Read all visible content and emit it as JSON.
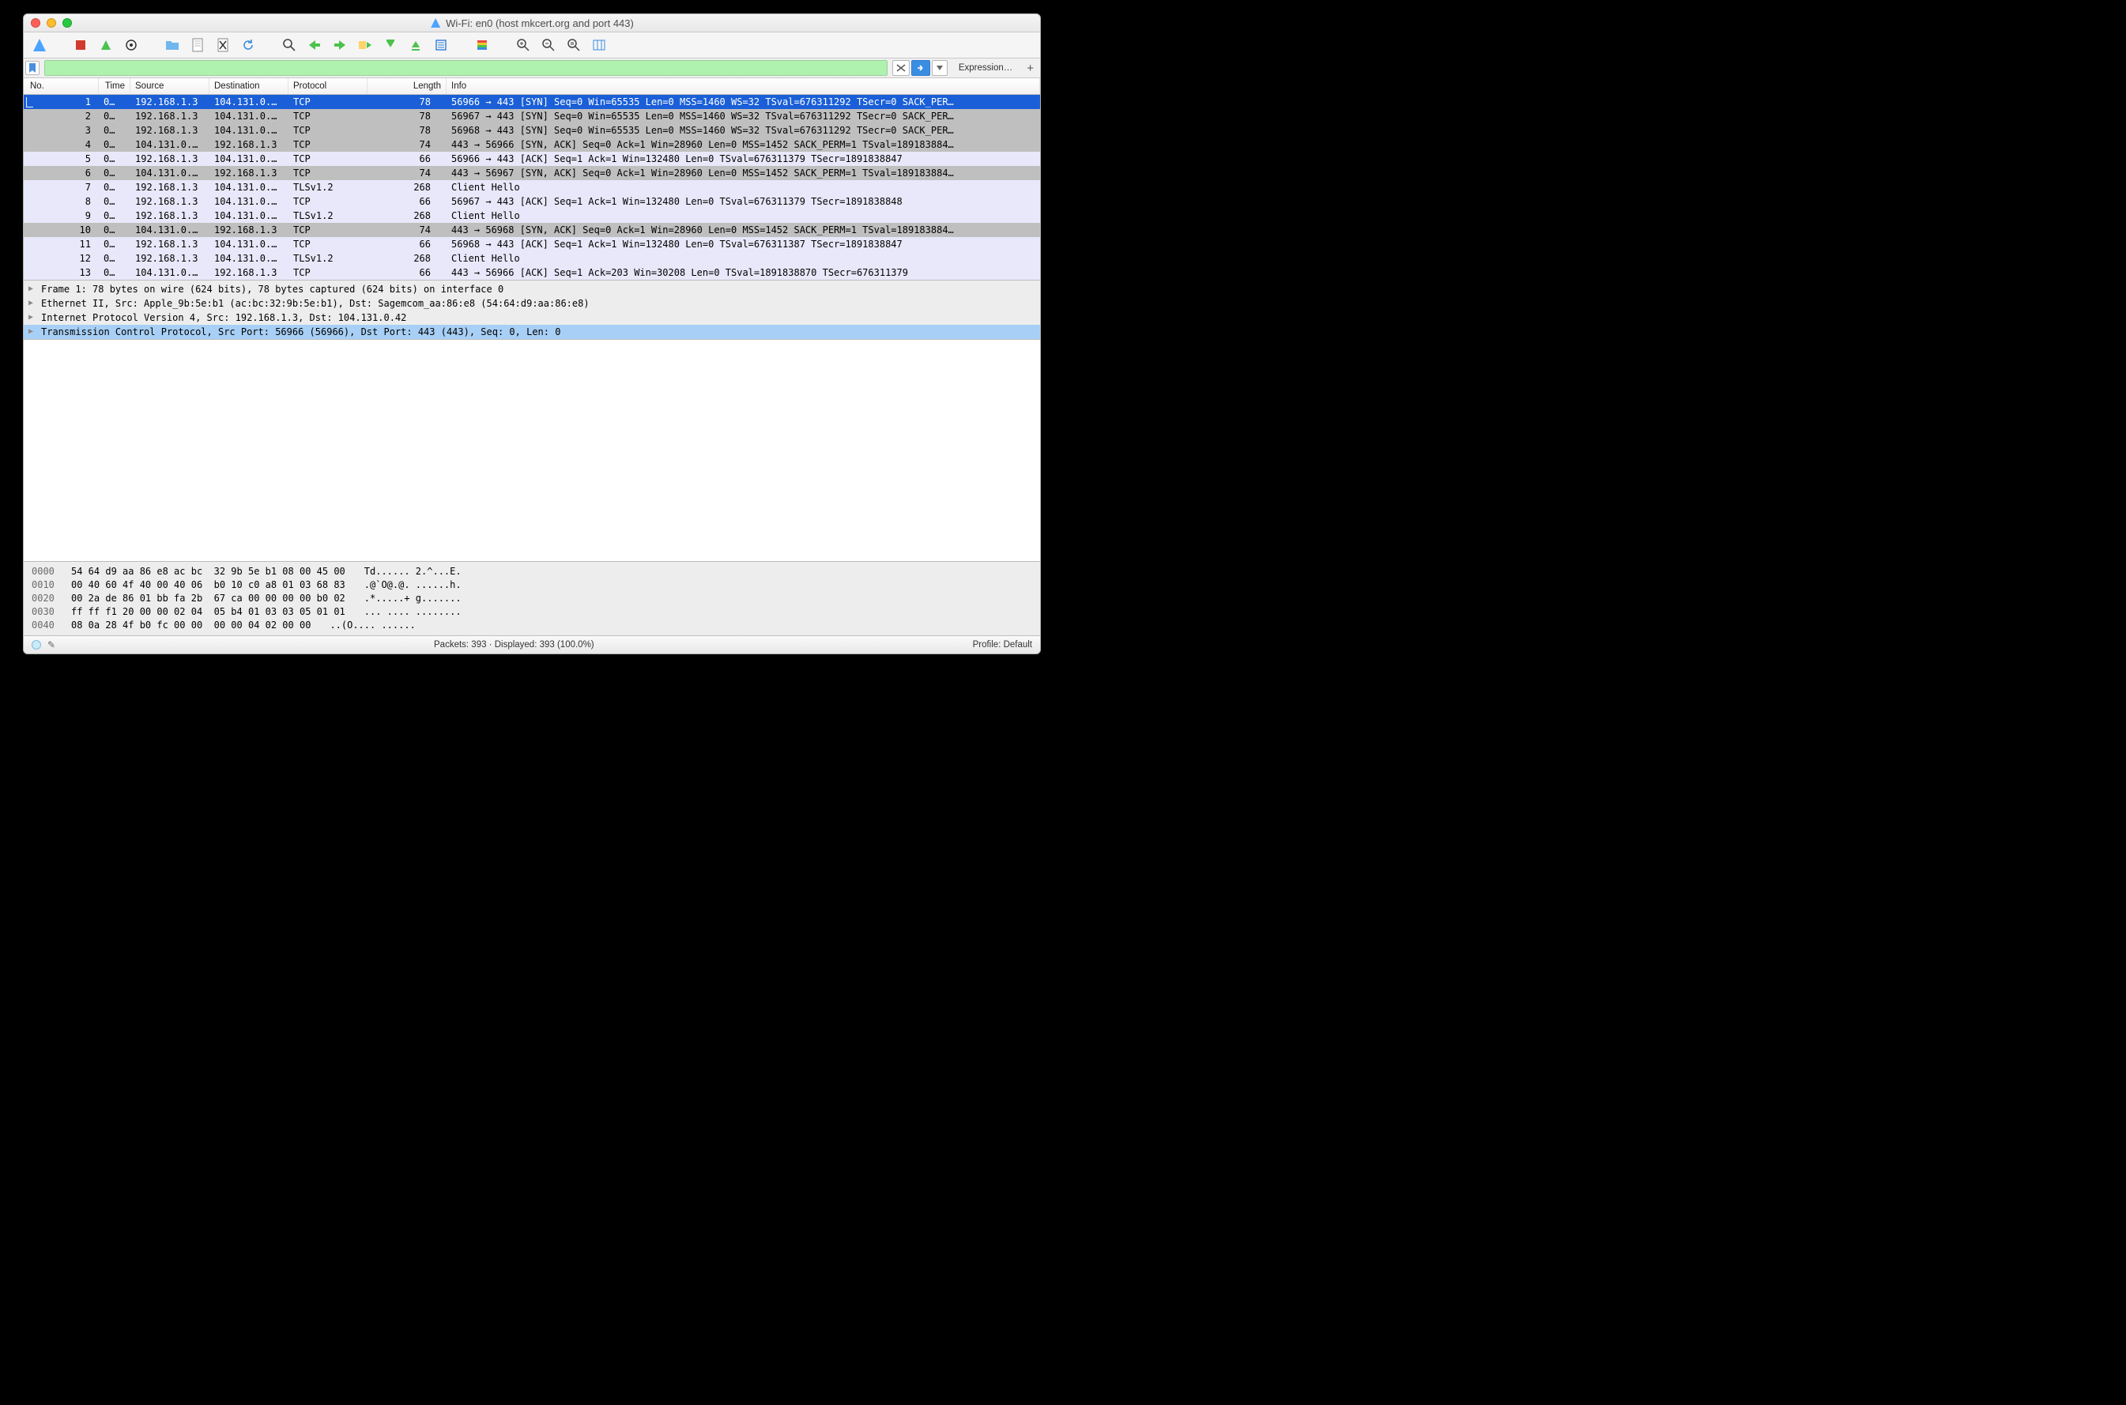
{
  "window": {
    "title": "Wi-Fi: en0 (host mkcert.org and port 443)"
  },
  "filter": {
    "expression_label": "Expression…"
  },
  "columns": {
    "no": "No.",
    "time": "Time",
    "source": "Source",
    "destination": "Destination",
    "protocol": "Protocol",
    "length": "Length",
    "info": "Info"
  },
  "packets": [
    {
      "no": 1,
      "time": "0…",
      "source": "192.168.1.3",
      "destination": "104.131.0.…",
      "protocol": "TCP",
      "length": 78,
      "info": "56966 → 443 [SYN] Seq=0 Win=65535 Len=0 MSS=1460 WS=32 TSval=676311292 TSecr=0 SACK_PER…",
      "style": "sel",
      "mark": true
    },
    {
      "no": 2,
      "time": "0…",
      "source": "192.168.1.3",
      "destination": "104.131.0.…",
      "protocol": "TCP",
      "length": 78,
      "info": "56967 → 443 [SYN] Seq=0 Win=65535 Len=0 MSS=1460 WS=32 TSval=676311292 TSecr=0 SACK_PER…",
      "style": "gray"
    },
    {
      "no": 3,
      "time": "0…",
      "source": "192.168.1.3",
      "destination": "104.131.0.…",
      "protocol": "TCP",
      "length": 78,
      "info": "56968 → 443 [SYN] Seq=0 Win=65535 Len=0 MSS=1460 WS=32 TSval=676311292 TSecr=0 SACK_PER…",
      "style": "gray"
    },
    {
      "no": 4,
      "time": "0…",
      "source": "104.131.0.…",
      "destination": "192.168.1.3",
      "protocol": "TCP",
      "length": 74,
      "info": "443 → 56966 [SYN, ACK] Seq=0 Ack=1 Win=28960 Len=0 MSS=1452 SACK_PERM=1 TSval=189183884…",
      "style": "gray"
    },
    {
      "no": 5,
      "time": "0…",
      "source": "192.168.1.3",
      "destination": "104.131.0.…",
      "protocol": "TCP",
      "length": 66,
      "info": "56966 → 443 [ACK] Seq=1 Ack=1 Win=132480 Len=0 TSval=676311379 TSecr=1891838847",
      "style": "lav"
    },
    {
      "no": 6,
      "time": "0…",
      "source": "104.131.0.…",
      "destination": "192.168.1.3",
      "protocol": "TCP",
      "length": 74,
      "info": "443 → 56967 [SYN, ACK] Seq=0 Ack=1 Win=28960 Len=0 MSS=1452 SACK_PERM=1 TSval=189183884…",
      "style": "gray"
    },
    {
      "no": 7,
      "time": "0…",
      "source": "192.168.1.3",
      "destination": "104.131.0.…",
      "protocol": "TLSv1.2",
      "length": 268,
      "info": "Client Hello",
      "style": "lav"
    },
    {
      "no": 8,
      "time": "0…",
      "source": "192.168.1.3",
      "destination": "104.131.0.…",
      "protocol": "TCP",
      "length": 66,
      "info": "56967 → 443 [ACK] Seq=1 Ack=1 Win=132480 Len=0 TSval=676311379 TSecr=1891838848",
      "style": "lav"
    },
    {
      "no": 9,
      "time": "0…",
      "source": "192.168.1.3",
      "destination": "104.131.0.…",
      "protocol": "TLSv1.2",
      "length": 268,
      "info": "Client Hello",
      "style": "lav"
    },
    {
      "no": 10,
      "time": "0…",
      "source": "104.131.0.…",
      "destination": "192.168.1.3",
      "protocol": "TCP",
      "length": 74,
      "info": "443 → 56968 [SYN, ACK] Seq=0 Ack=1 Win=28960 Len=0 MSS=1452 SACK_PERM=1 TSval=189183884…",
      "style": "gray"
    },
    {
      "no": 11,
      "time": "0…",
      "source": "192.168.1.3",
      "destination": "104.131.0.…",
      "protocol": "TCP",
      "length": 66,
      "info": "56968 → 443 [ACK] Seq=1 Ack=1 Win=132480 Len=0 TSval=676311387 TSecr=1891838847",
      "style": "lav"
    },
    {
      "no": 12,
      "time": "0…",
      "source": "192.168.1.3",
      "destination": "104.131.0.…",
      "protocol": "TLSv1.2",
      "length": 268,
      "info": "Client Hello",
      "style": "lav"
    },
    {
      "no": 13,
      "time": "0…",
      "source": "104.131.0.…",
      "destination": "192.168.1.3",
      "protocol": "TCP",
      "length": 66,
      "info": "443 → 56966 [ACK] Seq=1 Ack=203 Win=30208 Len=0 TSval=1891838870 TSecr=676311379",
      "style": "lav"
    }
  ],
  "details": [
    "Frame 1: 78 bytes on wire (624 bits), 78 bytes captured (624 bits) on interface 0",
    "Ethernet II, Src: Apple_9b:5e:b1 (ac:bc:32:9b:5e:b1), Dst: Sagemcom_aa:86:e8 (54:64:d9:aa:86:e8)",
    "Internet Protocol Version 4, Src: 192.168.1.3, Dst: 104.131.0.42",
    "Transmission Control Protocol, Src Port: 56966 (56966), Dst Port: 443 (443), Seq: 0, Len: 0"
  ],
  "hex": [
    {
      "off": "0000",
      "b": "54 64 d9 aa 86 e8 ac bc  32 9b 5e b1 08 00 45 00",
      "a": "Td...... 2.^...E."
    },
    {
      "off": "0010",
      "b": "00 40 60 4f 40 00 40 06  b0 10 c0 a8 01 03 68 83",
      "a": ".@`O@.@. ......h."
    },
    {
      "off": "0020",
      "b": "00 2a de 86 01 bb fa 2b  67 ca 00 00 00 00 b0 02",
      "a": ".*.....+ g......."
    },
    {
      "off": "0030",
      "b": "ff ff f1 20 00 00 02 04  05 b4 01 03 03 05 01 01",
      "a": "... .... ........"
    },
    {
      "off": "0040",
      "b": "08 0a 28 4f b0 fc 00 00  00 00 04 02 00 00",
      "a": "..(O.... ......"
    }
  ],
  "status": {
    "packets": "Packets: 393 · Displayed: 393 (100.0%)",
    "profile": "Profile: Default"
  }
}
